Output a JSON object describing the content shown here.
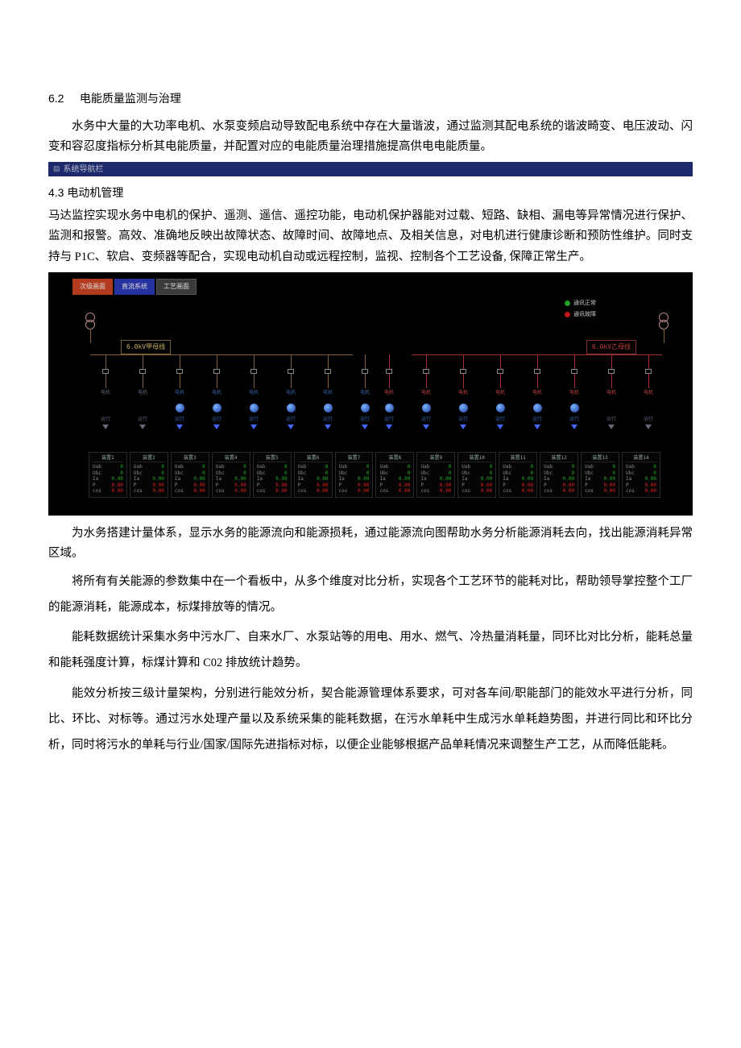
{
  "section62": {
    "num": "6.2",
    "title": "电能质量监测与治理",
    "para": "水务中大量的大功率电机、水泵变频启动导致配电系统中存在大量谐波，通过监测其配电系统的谐波畸变、电压波动、闪变和容忍度指标分析其电能质量，并配置对应的电能质量治理措施提高供电电能质量。"
  },
  "bar": {
    "text": "系统导航栏"
  },
  "section43": {
    "num": "4.3",
    "title": "电动机管理",
    "para": "马达监控实现水务中电机的保护、遥测、遥信、遥控功能，电动机保护器能对过载、短路、缺相、漏电等异常情况进行保护、监测和报警。高效、准确地反映出故障状态、故障时间、故障地点、及相关信息，对电机进行健康诊断和预防性维护。同时支持与 P1C、软启、变频器等配合，实现电动机自动或远程控制，监视、控制各个工艺设备, 保障正常生产。"
  },
  "scada": {
    "tabs": [
      "次级画面",
      "直流系统",
      "工艺画面"
    ],
    "legend": [
      {
        "color": "green",
        "label": "通讯正常"
      },
      {
        "color": "red",
        "label": "通讯故障"
      }
    ],
    "busbars": {
      "left": "6.0kV甲母线",
      "right": "6.0kV乙母线"
    },
    "feeder_label_top": "电机",
    "feeder_label_mid": "运行",
    "panel_header": "装置",
    "panel_rows": [
      {
        "k": "Uab",
        "v": "0",
        "cls": "green"
      },
      {
        "k": "Ubc",
        "v": "0",
        "cls": "green"
      },
      {
        "k": "Ia",
        "v": "0.00",
        "cls": "green"
      },
      {
        "k": "P",
        "v": "0.00",
        "cls": "red"
      },
      {
        "k": "cos",
        "v": "0.00",
        "cls": "red"
      }
    ]
  },
  "paras": [
    "为水务搭建计量体系，显示水务的能源流向和能源损耗，通过能源流向图帮助水务分析能源消耗去向，找出能源消耗异常区域。",
    "将所有有关能源的参数集中在一个看板中，从多个维度对比分析，实现各个工艺环节的能耗对比，帮助领导掌控整个工厂的能源消耗，能源成本，标煤排放等的情况。",
    "能耗数据统计采集水务中污水厂、自来水厂、水泵站等的用电、用水、燃气、冷热量消耗量，同环比对比分析，能耗总量和能耗强度计算，标煤计算和 C02 排放统计趋势。",
    "能效分析按三级计量架构，分别进行能效分析，契合能源管理体系要求，可对各车间/职能部门的能效水平进行分析，同比、环比、对标等。通过污水处理产量以及系统采集的能耗数据，在污水单耗中生成污水单耗趋势图，并进行同比和环比分析，同时将污水的单耗与行业/国家/国际先进指标对标，以便企业能够根据产品单耗情况来调整生产工艺，从而降低能耗。"
  ]
}
